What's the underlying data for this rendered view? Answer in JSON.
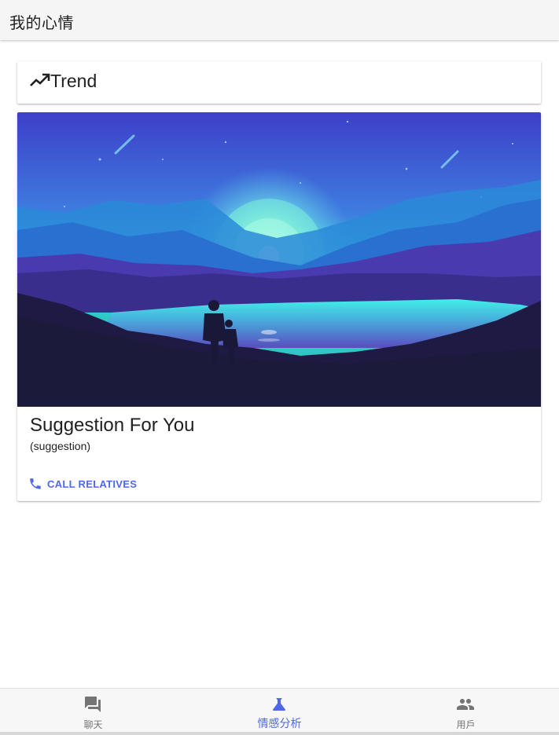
{
  "appbar": {
    "title": "我的心情"
  },
  "trend_card": {
    "icon": "trending-up-icon",
    "title": "Trend"
  },
  "suggestion_card": {
    "image": "night-landscape-illustration",
    "title": "Suggestion For You",
    "subtitle": "(suggestion)",
    "action": {
      "icon": "phone-icon",
      "label": "CALL RELATIVES"
    }
  },
  "bottom_nav": {
    "items": [
      {
        "icon": "chat-icon",
        "label": "聊天",
        "active": false
      },
      {
        "icon": "flask-icon",
        "label": "情感分析",
        "active": true
      },
      {
        "icon": "people-icon",
        "label": "用戶",
        "active": false
      }
    ]
  },
  "colors": {
    "accent": "#5068e8",
    "appbar_bg": "#f5f5f5",
    "text_primary": "#212121",
    "nav_inactive": "#757575"
  }
}
